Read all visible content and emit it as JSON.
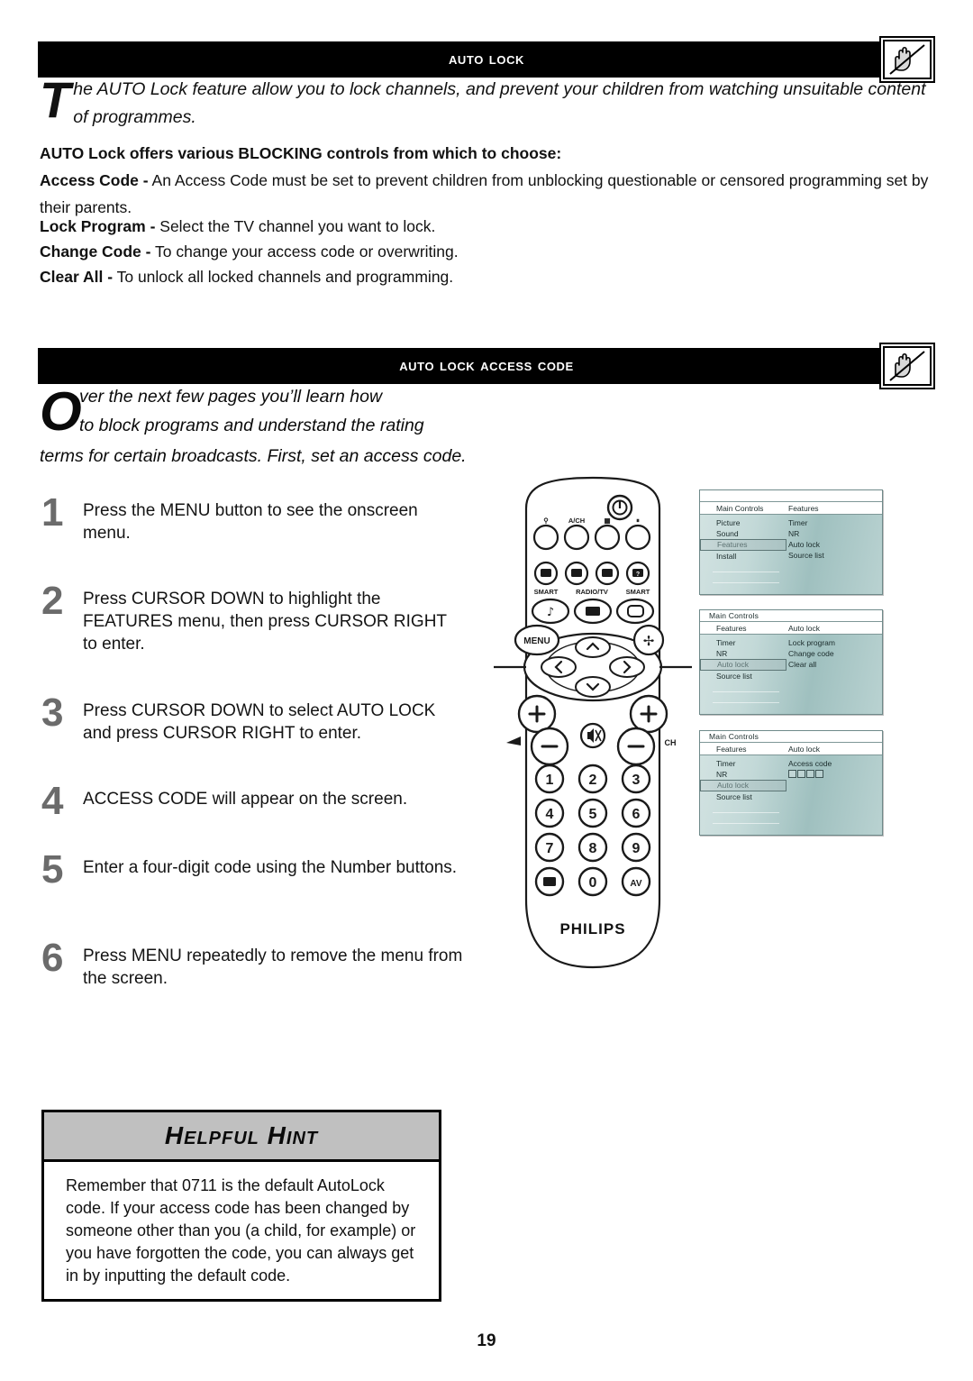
{
  "page": {
    "number": "19"
  },
  "section1": {
    "header": {
      "title": "Auto Lock",
      "icon": "no-touch-hand-tv-icon"
    },
    "intro": {
      "dropcap": "T",
      "text": "he AUTO Lock feature allow you to lock channels, and prevent your children from watching unsuitable content of programmes."
    },
    "lead": "AUTO Lock offers various BLOCKING controls from which to choose:",
    "definitions": [
      {
        "term": "Access Code",
        "dash": "-",
        "desc": "An Access Code must be set to prevent children from unblocking questionable or censored programming set by their parents."
      },
      {
        "term": "Lock Program",
        "dash": "-",
        "desc": "Select the TV channel you want to lock."
      },
      {
        "term": "Change Code",
        "dash": "-",
        "desc": "To change your access code or overwriting."
      },
      {
        "term": "Clear All",
        "dash": "-",
        "desc": "To unlock all locked channels and programming."
      }
    ]
  },
  "section2": {
    "header": {
      "title": "Auto Lock Access Code",
      "icon": "no-touch-hand-tv-icon"
    },
    "intro": {
      "dropcap": "O",
      "line1": "ver the next few pages you’ll learn how",
      "line2": "to block programs and understand the rating",
      "line3": "terms for certain broadcasts. First, set an access code."
    },
    "steps": [
      {
        "num": "1",
        "text": "Press the MENU  button to see the onscreen menu."
      },
      {
        "num": "2",
        "text": "Press CURSOR DOWN to highlight the FEATURES menu, then press CURSOR RIGHT to enter."
      },
      {
        "num": "3",
        "text": "Press CURSOR DOWN to select AUTO LOCK and press CURSOR RIGHT to enter."
      },
      {
        "num": "4",
        "text": "ACCESS CODE will appear on the screen."
      },
      {
        "num": "5",
        "text": "Enter a four-digit code using the Number buttons."
      },
      {
        "num": "6",
        "text": "Press MENU repeatedly to remove the menu from the screen."
      }
    ]
  },
  "remote": {
    "brand": "PHILIPS",
    "top_row_labels": [
      "",
      "A/CH",
      "",
      ""
    ],
    "top_row_icons": [
      "surf-icon",
      "alternate-channel-icon",
      "pip-icon",
      "freeze-icon"
    ],
    "power_icon": "power-icon",
    "second_row_icons": [
      "smart-picture-icon",
      "format-icon",
      "smart-sound-icon",
      "info-icon"
    ],
    "third_row_labels": [
      "SMART",
      "RADIO/TV",
      "SMART"
    ],
    "third_row_icons": [
      "music-note-icon",
      "radio-tv-icon",
      "screen-icon"
    ],
    "menu_label": "MENU",
    "cursor_icons": [
      "cursor-up-icon",
      "cursor-left-icon",
      "cursor-right-icon",
      "cursor-down-icon"
    ],
    "expand_icon": "expand-icon",
    "volume_label": "",
    "channel_label": "CH",
    "mute_icon": "mute-icon",
    "plus_label": "+",
    "minus_label": "−",
    "numpad": [
      "1",
      "2",
      "3",
      "4",
      "5",
      "6",
      "7",
      "8",
      "9",
      "",
      "0",
      "AV"
    ],
    "numpad_extra_icon": "pip-source-icon"
  },
  "tv_menus": [
    {
      "name": "menu-features-highlighted",
      "topbar": "",
      "head_left": "Main Controls",
      "head_right": "Features",
      "left_items": [
        "Picture",
        "Sound",
        "Features",
        "Install"
      ],
      "left_selected_index": 2,
      "right_items": [
        "Timer",
        "NR",
        "Auto lock",
        "Source list"
      ],
      "code_boxes": 0
    },
    {
      "name": "menu-auto-lock-highlighted",
      "topbar": "Main Controls",
      "head_left": "Features",
      "head_right": "Auto lock",
      "left_items": [
        "Timer",
        "NR",
        "Auto lock",
        "Source list"
      ],
      "left_selected_index": 2,
      "right_items": [
        "Lock program",
        "Change code",
        "Clear all"
      ],
      "code_boxes": 0
    },
    {
      "name": "menu-access-code-entry",
      "topbar": "Main Controls",
      "head_left": "Features",
      "head_right": "Auto lock",
      "left_items": [
        "Timer",
        "NR",
        "Auto lock",
        "Source list"
      ],
      "left_selected_index": 2,
      "right_items": [
        "Access code"
      ],
      "code_boxes": 4
    }
  ],
  "hint": {
    "title": "Helpful Hint",
    "body": "Remember that 0711 is the default AutoLock code. If your access code has been changed by someone other than you (a child, for example) or you have forgotten the code, you can always get in by inputting the default code."
  },
  "colors": {
    "bar_bg": "#000000",
    "bar_fg": "#ffffff",
    "step_number": "#6b6b6b",
    "hint_header_bg": "#c0c0c0",
    "tv_menu_bg": "#b9d2d1"
  }
}
